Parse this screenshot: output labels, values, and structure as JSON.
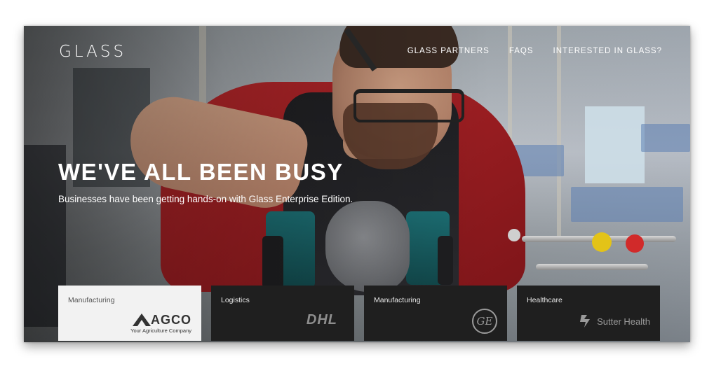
{
  "brand": {
    "logo_text": "GLASS"
  },
  "nav": {
    "items": [
      {
        "label": "GLASS PARTNERS"
      },
      {
        "label": "FAQS"
      },
      {
        "label": "INTERESTED IN GLASS?"
      }
    ]
  },
  "hero": {
    "title": "WE'VE ALL BEEN BUSY",
    "subtitle": "Businesses have been getting hands-on with Glass Enterprise Edition.",
    "image_subject": "factory-worker-wearing-glass-with-drill"
  },
  "cards": [
    {
      "category": "Manufacturing",
      "logo_word": "AGCO",
      "logo_tagline": "Your Agriculture Company",
      "icon": "agco-logo-icon"
    },
    {
      "category": "Logistics",
      "logo_word": "DHL",
      "icon": "dhl-logo-icon"
    },
    {
      "category": "Manufacturing",
      "logo_word": "GE",
      "icon": "ge-logo-icon"
    },
    {
      "category": "Healthcare",
      "logo_word": "Sutter Health",
      "icon": "sutter-health-logo-icon"
    }
  ],
  "colors": {
    "card_dark": "#1f1f1f",
    "card_light": "#f2f2f2",
    "text_white": "#ffffff",
    "logo_gray": "#8e8e8e",
    "shirt_red": "#b8282b"
  }
}
